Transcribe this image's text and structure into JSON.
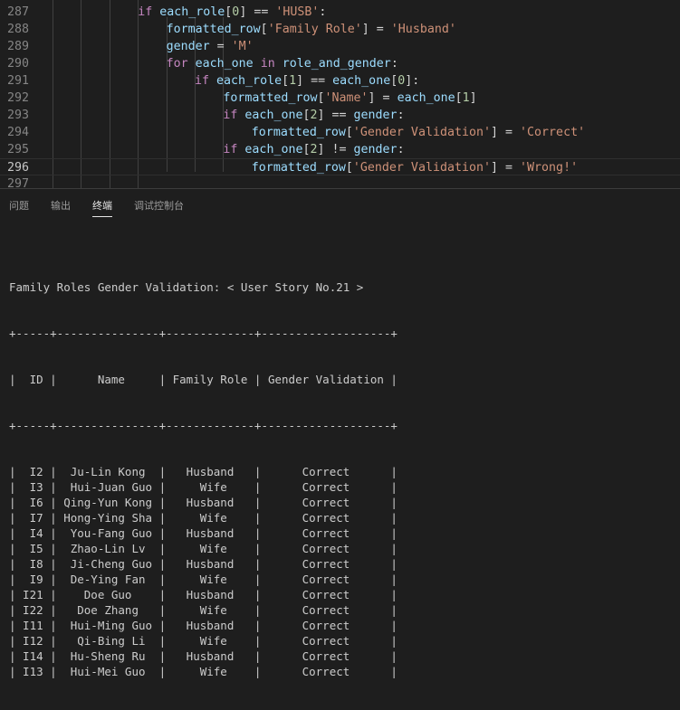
{
  "editor": {
    "lines": [
      {
        "num": "287",
        "indent": 12,
        "tokens": [
          [
            "k",
            "if"
          ],
          [
            "o",
            " "
          ],
          [
            "v",
            "each_role"
          ],
          [
            "o",
            "["
          ],
          [
            "n",
            "0"
          ],
          [
            "o",
            "] == "
          ],
          [
            "s",
            "'HUSB'"
          ],
          [
            "o",
            ":"
          ]
        ]
      },
      {
        "num": "288",
        "indent": 16,
        "tokens": [
          [
            "v",
            "formatted_row"
          ],
          [
            "o",
            "["
          ],
          [
            "s",
            "'Family Role'"
          ],
          [
            "o",
            "] = "
          ],
          [
            "s",
            "'Husband'"
          ]
        ]
      },
      {
        "num": "289",
        "indent": 16,
        "tokens": [
          [
            "v",
            "gender"
          ],
          [
            "o",
            " = "
          ],
          [
            "s",
            "'M'"
          ]
        ]
      },
      {
        "num": "290",
        "indent": 16,
        "tokens": [
          [
            "k",
            "for"
          ],
          [
            "o",
            " "
          ],
          [
            "v",
            "each_one"
          ],
          [
            "o",
            " "
          ],
          [
            "k",
            "in"
          ],
          [
            "o",
            " "
          ],
          [
            "v",
            "role_and_gender"
          ],
          [
            "o",
            ":"
          ]
        ]
      },
      {
        "num": "291",
        "indent": 20,
        "tokens": [
          [
            "k",
            "if"
          ],
          [
            "o",
            " "
          ],
          [
            "v",
            "each_role"
          ],
          [
            "o",
            "["
          ],
          [
            "n",
            "1"
          ],
          [
            "o",
            "] == "
          ],
          [
            "v",
            "each_one"
          ],
          [
            "o",
            "["
          ],
          [
            "n",
            "0"
          ],
          [
            "o",
            "]:"
          ]
        ]
      },
      {
        "num": "292",
        "indent": 24,
        "tokens": [
          [
            "v",
            "formatted_row"
          ],
          [
            "o",
            "["
          ],
          [
            "s",
            "'Name'"
          ],
          [
            "o",
            "] = "
          ],
          [
            "v",
            "each_one"
          ],
          [
            "o",
            "["
          ],
          [
            "n",
            "1"
          ],
          [
            "o",
            "]"
          ]
        ]
      },
      {
        "num": "293",
        "indent": 24,
        "tokens": [
          [
            "k",
            "if"
          ],
          [
            "o",
            " "
          ],
          [
            "v",
            "each_one"
          ],
          [
            "o",
            "["
          ],
          [
            "n",
            "2"
          ],
          [
            "o",
            "] == "
          ],
          [
            "v",
            "gender"
          ],
          [
            "o",
            ":"
          ]
        ]
      },
      {
        "num": "294",
        "indent": 28,
        "tokens": [
          [
            "v",
            "formatted_row"
          ],
          [
            "o",
            "["
          ],
          [
            "s",
            "'Gender Validation'"
          ],
          [
            "o",
            "] = "
          ],
          [
            "s",
            "'Correct'"
          ]
        ]
      },
      {
        "num": "295",
        "indent": 24,
        "tokens": [
          [
            "k",
            "if"
          ],
          [
            "o",
            " "
          ],
          [
            "v",
            "each_one"
          ],
          [
            "o",
            "["
          ],
          [
            "n",
            "2"
          ],
          [
            "o",
            "] != "
          ],
          [
            "v",
            "gender"
          ],
          [
            "o",
            ":"
          ]
        ]
      },
      {
        "num": "296",
        "indent": 28,
        "current": true,
        "tokens": [
          [
            "v",
            "formatted_row"
          ],
          [
            "o",
            "["
          ],
          [
            "s",
            "'Gender Validation'"
          ],
          [
            "o",
            "] = "
          ],
          [
            "s",
            "'Wrong!'"
          ]
        ]
      },
      {
        "num": "297",
        "indent": 0,
        "tokens": []
      }
    ]
  },
  "panel": {
    "tabs": [
      {
        "label": "问题",
        "active": false
      },
      {
        "label": "输出",
        "active": false
      },
      {
        "label": "终端",
        "active": true
      },
      {
        "label": "调试控制台",
        "active": false
      }
    ]
  },
  "terminal": {
    "title": "Family Roles Gender Validation: < User Story No.21 >",
    "border": "+-----+---------------+-------------+-------------------+",
    "headers": [
      "ID",
      "Name",
      "Family Role",
      "Gender Validation"
    ],
    "rows": [
      [
        "I2",
        "Ju-Lin Kong",
        "Husband",
        "Correct"
      ],
      [
        "I3",
        "Hui-Juan Guo",
        "Wife",
        "Correct"
      ],
      [
        "I6",
        "Qing-Yun Kong",
        "Husband",
        "Correct"
      ],
      [
        "I7",
        "Hong-Ying Sha",
        "Wife",
        "Correct"
      ],
      [
        "I4",
        "You-Fang Guo",
        "Husband",
        "Correct"
      ],
      [
        "I5",
        "Zhao-Lin Lv",
        "Wife",
        "Correct"
      ],
      [
        "I8",
        "Ji-Cheng Guo",
        "Husband",
        "Correct"
      ],
      [
        "I9",
        "De-Ying Fan",
        "Wife",
        "Correct"
      ],
      [
        "I21",
        "Doe Guo",
        "Husband",
        "Correct"
      ],
      [
        "I22",
        "Doe Zhang",
        "Wife",
        "Correct"
      ],
      [
        "I11",
        "Hui-Ming Guo",
        "Husband",
        "Correct"
      ],
      [
        "I12",
        "Qi-Bing Li",
        "Wife",
        "Correct"
      ],
      [
        "I14",
        "Hu-Sheng Ru",
        "Husband",
        "Correct"
      ],
      [
        "I13",
        "Hui-Mei Guo",
        "Wife",
        "Correct"
      ]
    ]
  },
  "colors": {
    "background": "#1e1e1e",
    "keyword": "#c586c0",
    "string": "#ce9178",
    "variable": "#9cdcfe",
    "number": "#b5cea8",
    "line_number": "#858585"
  }
}
